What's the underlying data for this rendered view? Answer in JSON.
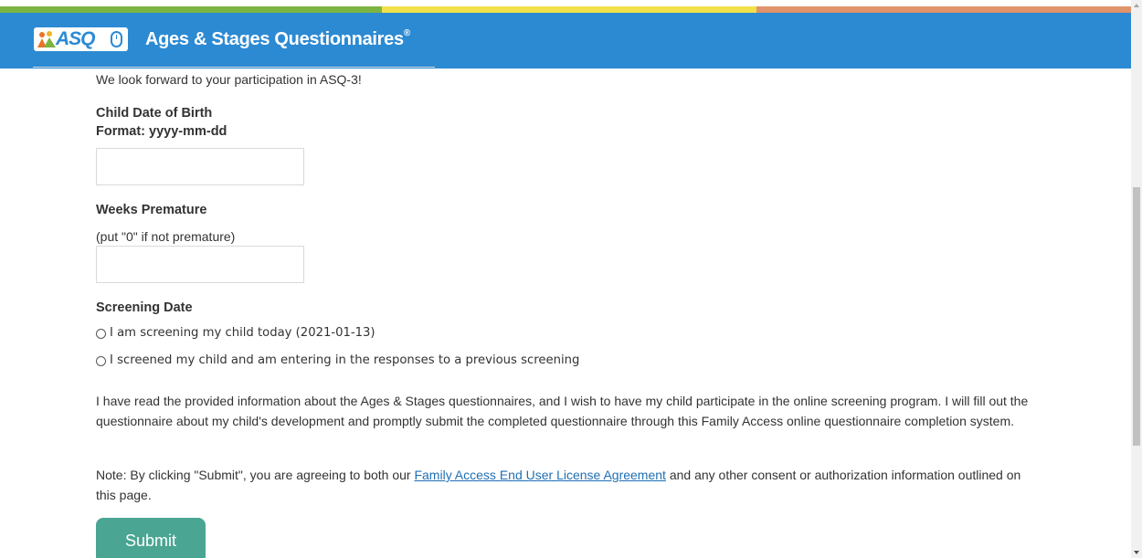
{
  "header": {
    "logo_text": "ASQ",
    "title": "Ages & Stages Questionnaires",
    "title_mark": "®"
  },
  "intro": "We look forward to your participation in ASQ-3!",
  "dob": {
    "label": "Child Date of Birth",
    "format": "Format: yyyy-mm-dd",
    "value": ""
  },
  "premature": {
    "label": "Weeks Premature",
    "hint": "(put \"0\" if not premature)",
    "value": ""
  },
  "screening": {
    "label": "Screening Date",
    "option_today": "I am screening my child today (2021-01-13)",
    "option_previous": "I screened my child and am entering in the responses to a previous screening"
  },
  "consent_text": "I have read the provided information about the Ages & Stages questionnaires, and I wish to have my child participate in the online screening program. I will fill out the questionnaire about my child's development and promptly submit the completed questionnaire through this Family Access online questionnaire completion system.",
  "note": {
    "prefix": "Note: By clicking \"Submit\", you are agreeing to both our ",
    "link": "Family Access End User License Agreement",
    "suffix": " and any other consent or authorization information outlined on this page."
  },
  "submit_label": "Submit",
  "colors": {
    "header": "#2c8ad3",
    "stripe_green": "#7cb441",
    "stripe_yellow": "#f2e04a",
    "stripe_orange": "#e0946a",
    "submit": "#4aa592",
    "link": "#1f6fb3"
  }
}
